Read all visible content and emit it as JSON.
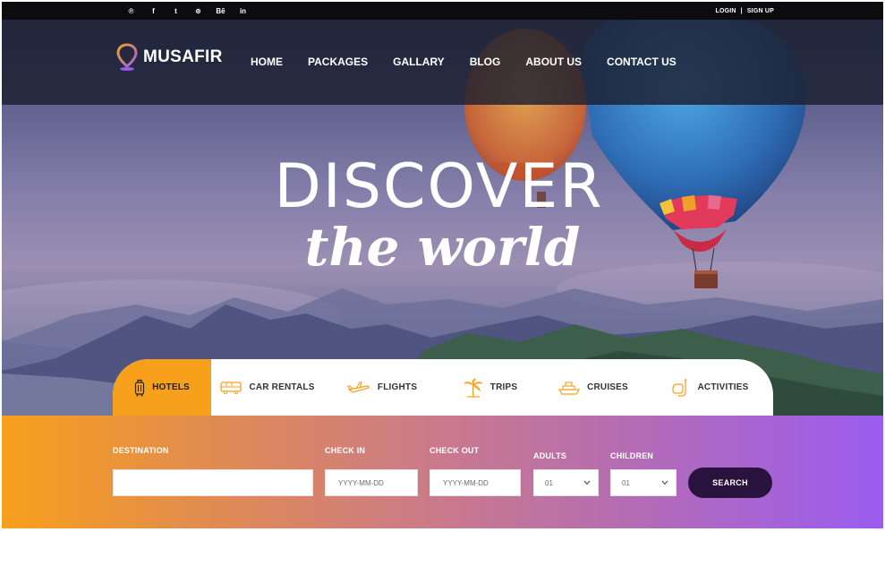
{
  "topbar": {
    "social_icons": [
      "pinterest-icon",
      "facebook-icon",
      "twitter-icon",
      "dribbble-icon",
      "behance-icon",
      "linkedin-icon"
    ],
    "social_glyphs": [
      "℗",
      "f",
      "t",
      "⊛",
      "Bē",
      "in"
    ],
    "login": "LOGIN",
    "separator": "|",
    "signup": "SIGN UP"
  },
  "brand": {
    "name": "MUSAFIR"
  },
  "nav": {
    "items": [
      "HOME",
      "PACKAGES",
      "GALLARY",
      "BLOG",
      "ABOUT US",
      "CONTACT US"
    ]
  },
  "hero": {
    "title": "DISCOVER",
    "subtitle": "the world"
  },
  "tabs": {
    "active": "HOTELS",
    "items": [
      {
        "label": "HOTELS",
        "icon": "luggage-icon"
      },
      {
        "label": "CAR RENTALS",
        "icon": "bus-icon"
      },
      {
        "label": "FLIGHTS",
        "icon": "airplane-icon"
      },
      {
        "label": "TRIPS",
        "icon": "palm-tree-icon"
      },
      {
        "label": "CRUISES",
        "icon": "ship-icon"
      },
      {
        "label": "ACTIVITIES",
        "icon": "snorkel-icon"
      }
    ]
  },
  "search": {
    "destination_label": "DESTINATION",
    "destination_value": "",
    "checkin_label": "CHECK IN",
    "checkin_placeholder": "YYYY-MM-DD",
    "checkout_label": "CHECK OUT",
    "checkout_placeholder": "YYYY-MM-DD",
    "adults_label": "ADULTS",
    "adults_value": "01",
    "children_label": "CHILDREN",
    "children_value": "01",
    "button": "SEARCH"
  },
  "colors": {
    "accent_orange": "#f7a01c",
    "accent_purple": "#9b5cf0",
    "button_dark": "#2a123f"
  }
}
